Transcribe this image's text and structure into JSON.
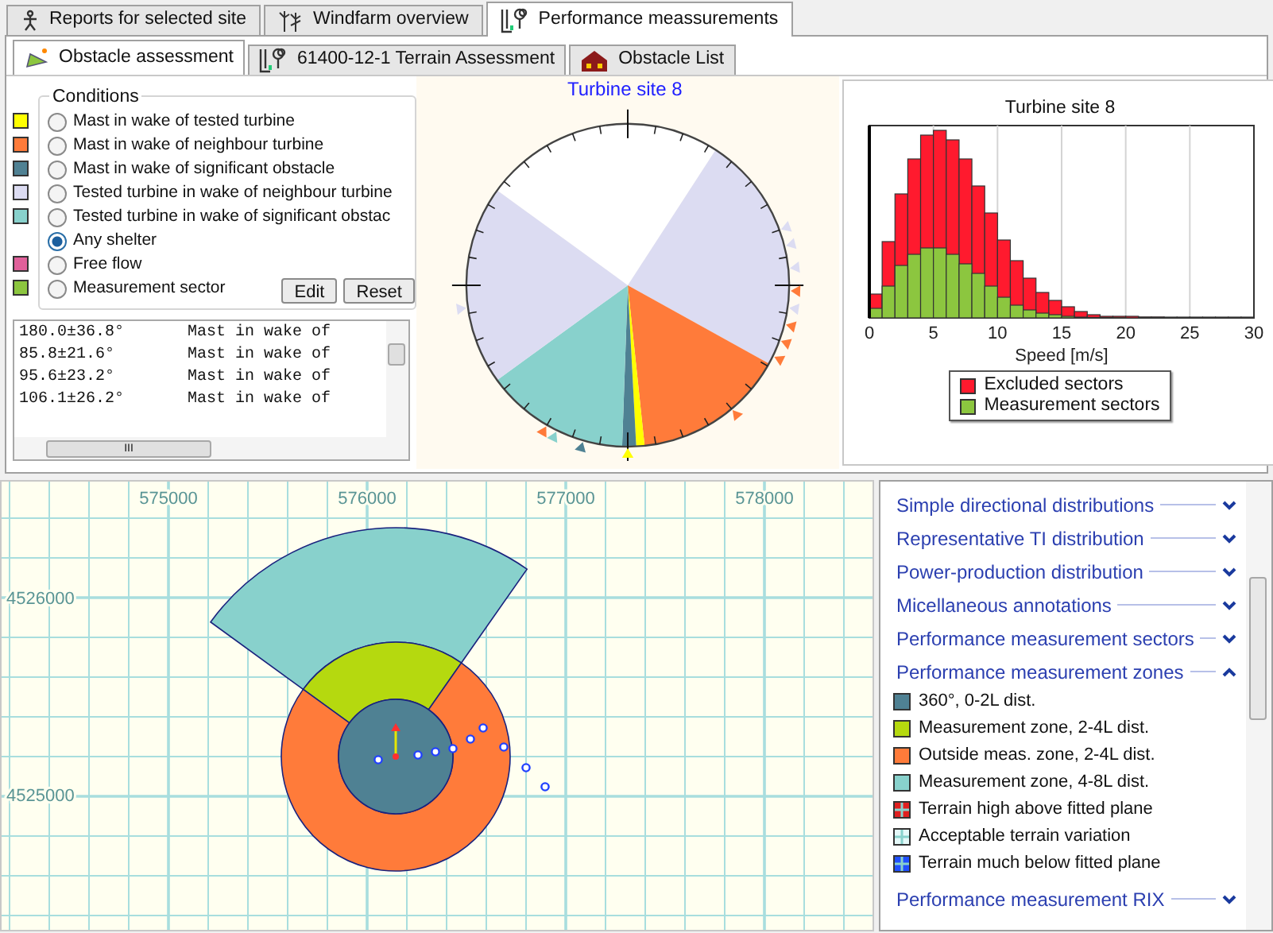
{
  "tabs": [
    {
      "label": "Reports for selected site",
      "selected": false
    },
    {
      "label": "Windfarm overview",
      "selected": false
    },
    {
      "label": "Performance meassurements",
      "selected": true
    }
  ],
  "subtabs": [
    {
      "label": "Obstacle assessment",
      "selected": true
    },
    {
      "label": "61400-12-1 Terrain Assessment",
      "selected": false
    },
    {
      "label": "Obstacle List",
      "selected": false
    }
  ],
  "conditions": {
    "title": "Conditions",
    "options": [
      {
        "label": "Mast in wake of tested turbine",
        "color": "#ffff00",
        "selected": false
      },
      {
        "label": "Mast in wake of neighbour turbine",
        "color": "#ff7b3a",
        "selected": false
      },
      {
        "label": "Mast in wake of significant obstacle",
        "color": "#4f8193",
        "selected": false
      },
      {
        "label": "Tested turbine in wake of neighbour turbine",
        "color": "#dcdcf2",
        "selected": false
      },
      {
        "label": "Tested turbine in wake of significant obstac",
        "color": "#88d1cc",
        "selected": false
      },
      {
        "label": "Any shelter",
        "selected": true
      },
      {
        "label": "Free flow",
        "color": "#e0609a",
        "selected": false
      },
      {
        "label": "Measurement sector",
        "color": "#8cc63f",
        "selected": false
      }
    ],
    "buttons": [
      "Edit",
      "Reset"
    ]
  },
  "sector_list": {
    "rows": [
      {
        "direction": "180.0±36.8°",
        "description": "Mast in wake of"
      },
      {
        "direction": "85.8±21.6°",
        "description": "Mast in wake of"
      },
      {
        "direction": "95.6±23.2°",
        "description": "Mast in wake of"
      },
      {
        "direction": "106.1±26.2°",
        "description": "Mast in wake of"
      }
    ],
    "scroll_grip": "III"
  },
  "rose": {
    "title": "Turbine site 8"
  },
  "histogram": {
    "title": "Turbine site 8",
    "x_tick_labels": [
      "0",
      "5",
      "10",
      "15",
      "20",
      "25",
      "30"
    ],
    "xlabel": "Speed [m/s]",
    "legend": [
      {
        "label": "Excluded sectors",
        "color": "#ff1a2e"
      },
      {
        "label": "Measurement sectors",
        "color": "#8cc63f"
      }
    ]
  },
  "map": {
    "x_labels": [
      "575000",
      "576000",
      "577000",
      "578000"
    ],
    "y_labels": [
      "4526000",
      "4525000"
    ]
  },
  "layers": {
    "groups": [
      {
        "label": "Simple directional distributions",
        "expanded": false
      },
      {
        "label": "Representative TI distribution",
        "expanded": false
      },
      {
        "label": "Power-production distribution",
        "expanded": false
      },
      {
        "label": "Micellaneous annotations",
        "expanded": false
      },
      {
        "label": "Performance measurement sectors",
        "expanded": false
      },
      {
        "label": "Performance measurement zones",
        "expanded": true,
        "items": [
          {
            "label": "360°, 0-2L dist.",
            "kind": "swatch",
            "color": "#4f8193"
          },
          {
            "label": "Measurement zone, 2-4L dist.",
            "kind": "swatch",
            "color": "#b5d90f"
          },
          {
            "label": "Outside meas. zone, 2-4L dist.",
            "kind": "swatch",
            "color": "#ff7b3a"
          },
          {
            "label": "Measurement zone, 4-8L dist.",
            "kind": "swatch",
            "color": "#88d1cc"
          },
          {
            "label": "Terrain high above fitted plane",
            "kind": "pattern",
            "color": "#e02020"
          },
          {
            "label": "Acceptable terrain variation",
            "kind": "pattern",
            "color": "#e4f8f8"
          },
          {
            "label": "Terrain much below fitted plane",
            "kind": "pattern",
            "color": "#2050ff"
          }
        ]
      },
      {
        "label": "Performance measurement RIX",
        "expanded": false
      }
    ]
  }
}
